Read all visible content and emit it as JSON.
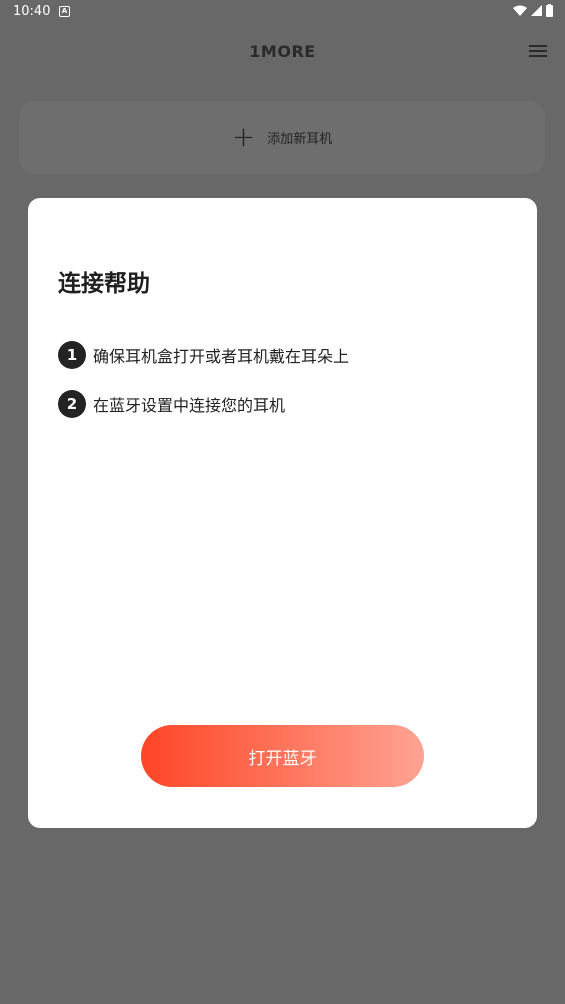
{
  "status_bar": {
    "time": "10:40",
    "app_icon_letter": "A"
  },
  "header": {
    "brand": "1MORE"
  },
  "add_card": {
    "label": "添加新耳机"
  },
  "dialog": {
    "title": "连接帮助",
    "steps": [
      {
        "number": "1",
        "text": "确保耳机盒打开或者耳机戴在耳朵上"
      },
      {
        "number": "2",
        "text": "在蓝牙设置中连接您的耳机"
      }
    ],
    "button_label": "打开蓝牙"
  },
  "colors": {
    "overlay_bg": "#686868",
    "button_gradient_start": "#ff4528",
    "button_gradient_end": "#ffa394"
  }
}
